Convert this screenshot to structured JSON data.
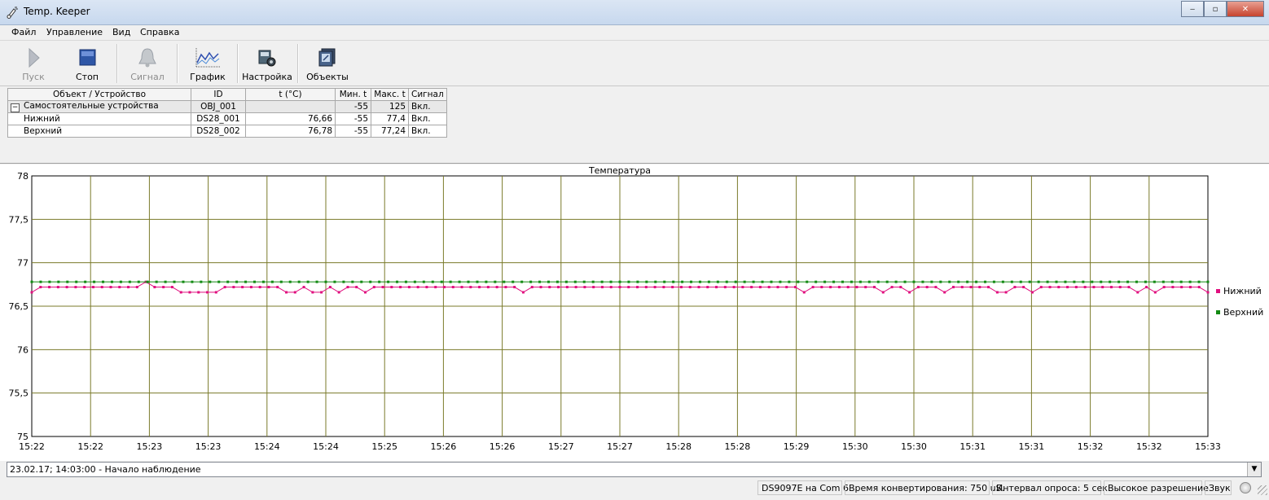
{
  "window": {
    "title": "Temp. Keeper",
    "min": "‒",
    "max": "▫",
    "close": "✕"
  },
  "menu": [
    "Файл",
    "Управление",
    "Вид",
    "Справка"
  ],
  "toolbar": [
    {
      "label": "Пуск",
      "icon": "play-icon",
      "enabled": false
    },
    {
      "label": "Стоп",
      "icon": "stop-icon",
      "enabled": true
    },
    {
      "label": "Сигнал",
      "icon": "bell-icon",
      "enabled": false
    },
    {
      "label": "График",
      "icon": "chart-icon",
      "enabled": true
    },
    {
      "label": "Настройка",
      "icon": "settings-icon",
      "enabled": true
    },
    {
      "label": "Объекты",
      "icon": "objects-icon",
      "enabled": true
    }
  ],
  "table": {
    "headers": [
      "Объект / Устройство",
      "ID",
      "t (°C)",
      "Мин. t",
      "Макс. t",
      "Сигнал"
    ],
    "group": {
      "expander": "−",
      "name": "Самостоятельные устройства",
      "id": "OBJ_001",
      "temp": "",
      "min": "-55",
      "max": "125",
      "signal": "Вкл."
    },
    "rows": [
      {
        "name": "Нижний",
        "id": "DS28_001",
        "temp": "76,66",
        "min": "-55",
        "max": "77,4",
        "signal": "Вкл."
      },
      {
        "name": "Верхний",
        "id": "DS28_002",
        "temp": "76,78",
        "min": "-55",
        "max": "77,24",
        "signal": "Вкл."
      }
    ]
  },
  "chart_data": {
    "type": "line",
    "title": "Температура",
    "xlabel": "",
    "ylabel": "",
    "ylim": [
      75,
      78
    ],
    "yticks": [
      "75",
      "75,5",
      "76",
      "76,5",
      "77",
      "77,5",
      "78"
    ],
    "x_tick_labels": [
      "15:22",
      "15:22",
      "15:23",
      "15:23",
      "15:24",
      "15:24",
      "15:25",
      "15:26",
      "15:26",
      "15:27",
      "15:27",
      "15:28",
      "15:28",
      "15:29",
      "15:30",
      "15:30",
      "15:31",
      "15:31",
      "15:32",
      "15:32",
      "15:33"
    ],
    "grid": true,
    "legend_position": "right",
    "series": [
      {
        "name": "Нижний",
        "color": "#e0107f",
        "values": [
          76.66,
          76.72,
          76.72,
          76.72,
          76.72,
          76.72,
          76.72,
          76.72,
          76.72,
          76.72,
          76.72,
          76.72,
          76.72,
          76.78,
          76.72,
          76.72,
          76.72,
          76.66,
          76.66,
          76.66,
          76.66,
          76.66,
          76.72,
          76.72,
          76.72,
          76.72,
          76.72,
          76.72,
          76.72,
          76.66,
          76.66,
          76.72,
          76.66,
          76.66,
          76.72,
          76.66,
          76.72,
          76.72,
          76.66,
          76.72,
          76.72,
          76.72,
          76.72,
          76.72,
          76.72,
          76.72,
          76.72,
          76.72,
          76.72,
          76.72,
          76.72,
          76.72,
          76.72,
          76.72,
          76.72,
          76.72,
          76.66,
          76.72,
          76.72,
          76.72,
          76.72,
          76.72,
          76.72,
          76.72,
          76.72,
          76.72,
          76.72,
          76.72,
          76.72,
          76.72,
          76.72,
          76.72,
          76.72,
          76.72,
          76.72,
          76.72,
          76.72,
          76.72,
          76.72,
          76.72,
          76.72,
          76.72,
          76.72,
          76.72,
          76.72,
          76.72,
          76.72,
          76.72,
          76.66,
          76.72,
          76.72,
          76.72,
          76.72,
          76.72,
          76.72,
          76.72,
          76.72,
          76.66,
          76.72,
          76.72,
          76.66,
          76.72,
          76.72,
          76.72,
          76.66,
          76.72,
          76.72,
          76.72,
          76.72,
          76.72,
          76.66,
          76.66,
          76.72,
          76.72,
          76.66,
          76.72,
          76.72,
          76.72,
          76.72,
          76.72,
          76.72,
          76.72,
          76.72,
          76.72,
          76.72,
          76.72,
          76.66,
          76.72,
          76.66,
          76.72,
          76.72,
          76.72,
          76.72,
          76.72,
          76.66
        ]
      },
      {
        "name": "Верхний",
        "color": "#138a13",
        "values": [
          76.78,
          76.78,
          76.78,
          76.78,
          76.78,
          76.78,
          76.78,
          76.78,
          76.78,
          76.78,
          76.78,
          76.78,
          76.78,
          76.78,
          76.78,
          76.78,
          76.78,
          76.78,
          76.78,
          76.78,
          76.78,
          76.78,
          76.78,
          76.78,
          76.78,
          76.78,
          76.78,
          76.78,
          76.78,
          76.78,
          76.78,
          76.78,
          76.78,
          76.78,
          76.78,
          76.78,
          76.78,
          76.78,
          76.78,
          76.78,
          76.78,
          76.78,
          76.78,
          76.78,
          76.78,
          76.78,
          76.78,
          76.78,
          76.78,
          76.78,
          76.78,
          76.78,
          76.78,
          76.78,
          76.78,
          76.78,
          76.78,
          76.78,
          76.78,
          76.78,
          76.78,
          76.78,
          76.78,
          76.78,
          76.78,
          76.78,
          76.78,
          76.78,
          76.78,
          76.78,
          76.78,
          76.78,
          76.78,
          76.78,
          76.78,
          76.78,
          76.78,
          76.78,
          76.78,
          76.78,
          76.78,
          76.78,
          76.78,
          76.78,
          76.78,
          76.78,
          76.78,
          76.78,
          76.78,
          76.78,
          76.78,
          76.78,
          76.78,
          76.78,
          76.78,
          76.78,
          76.78,
          76.78,
          76.78,
          76.78,
          76.78,
          76.78,
          76.78,
          76.78,
          76.78,
          76.78,
          76.78,
          76.78,
          76.78,
          76.78,
          76.78,
          76.78,
          76.78,
          76.78,
          76.78,
          76.78,
          76.78,
          76.78,
          76.78,
          76.78,
          76.78,
          76.78,
          76.78,
          76.78,
          76.78,
          76.78,
          76.78,
          76.78,
          76.78,
          76.78,
          76.78,
          76.78,
          76.78
        ]
      }
    ]
  },
  "log": {
    "text": "23.02.17; 14:03:00 - Начало наблюдение",
    "drop": "▼"
  },
  "status": {
    "port": "DS9097E на Com 6",
    "convert": "Время конвертирования: 750 uS.",
    "interval": "Интервал опроса: 5 сек.",
    "resolution": "Высокое разрешение",
    "sound": "Звук"
  }
}
